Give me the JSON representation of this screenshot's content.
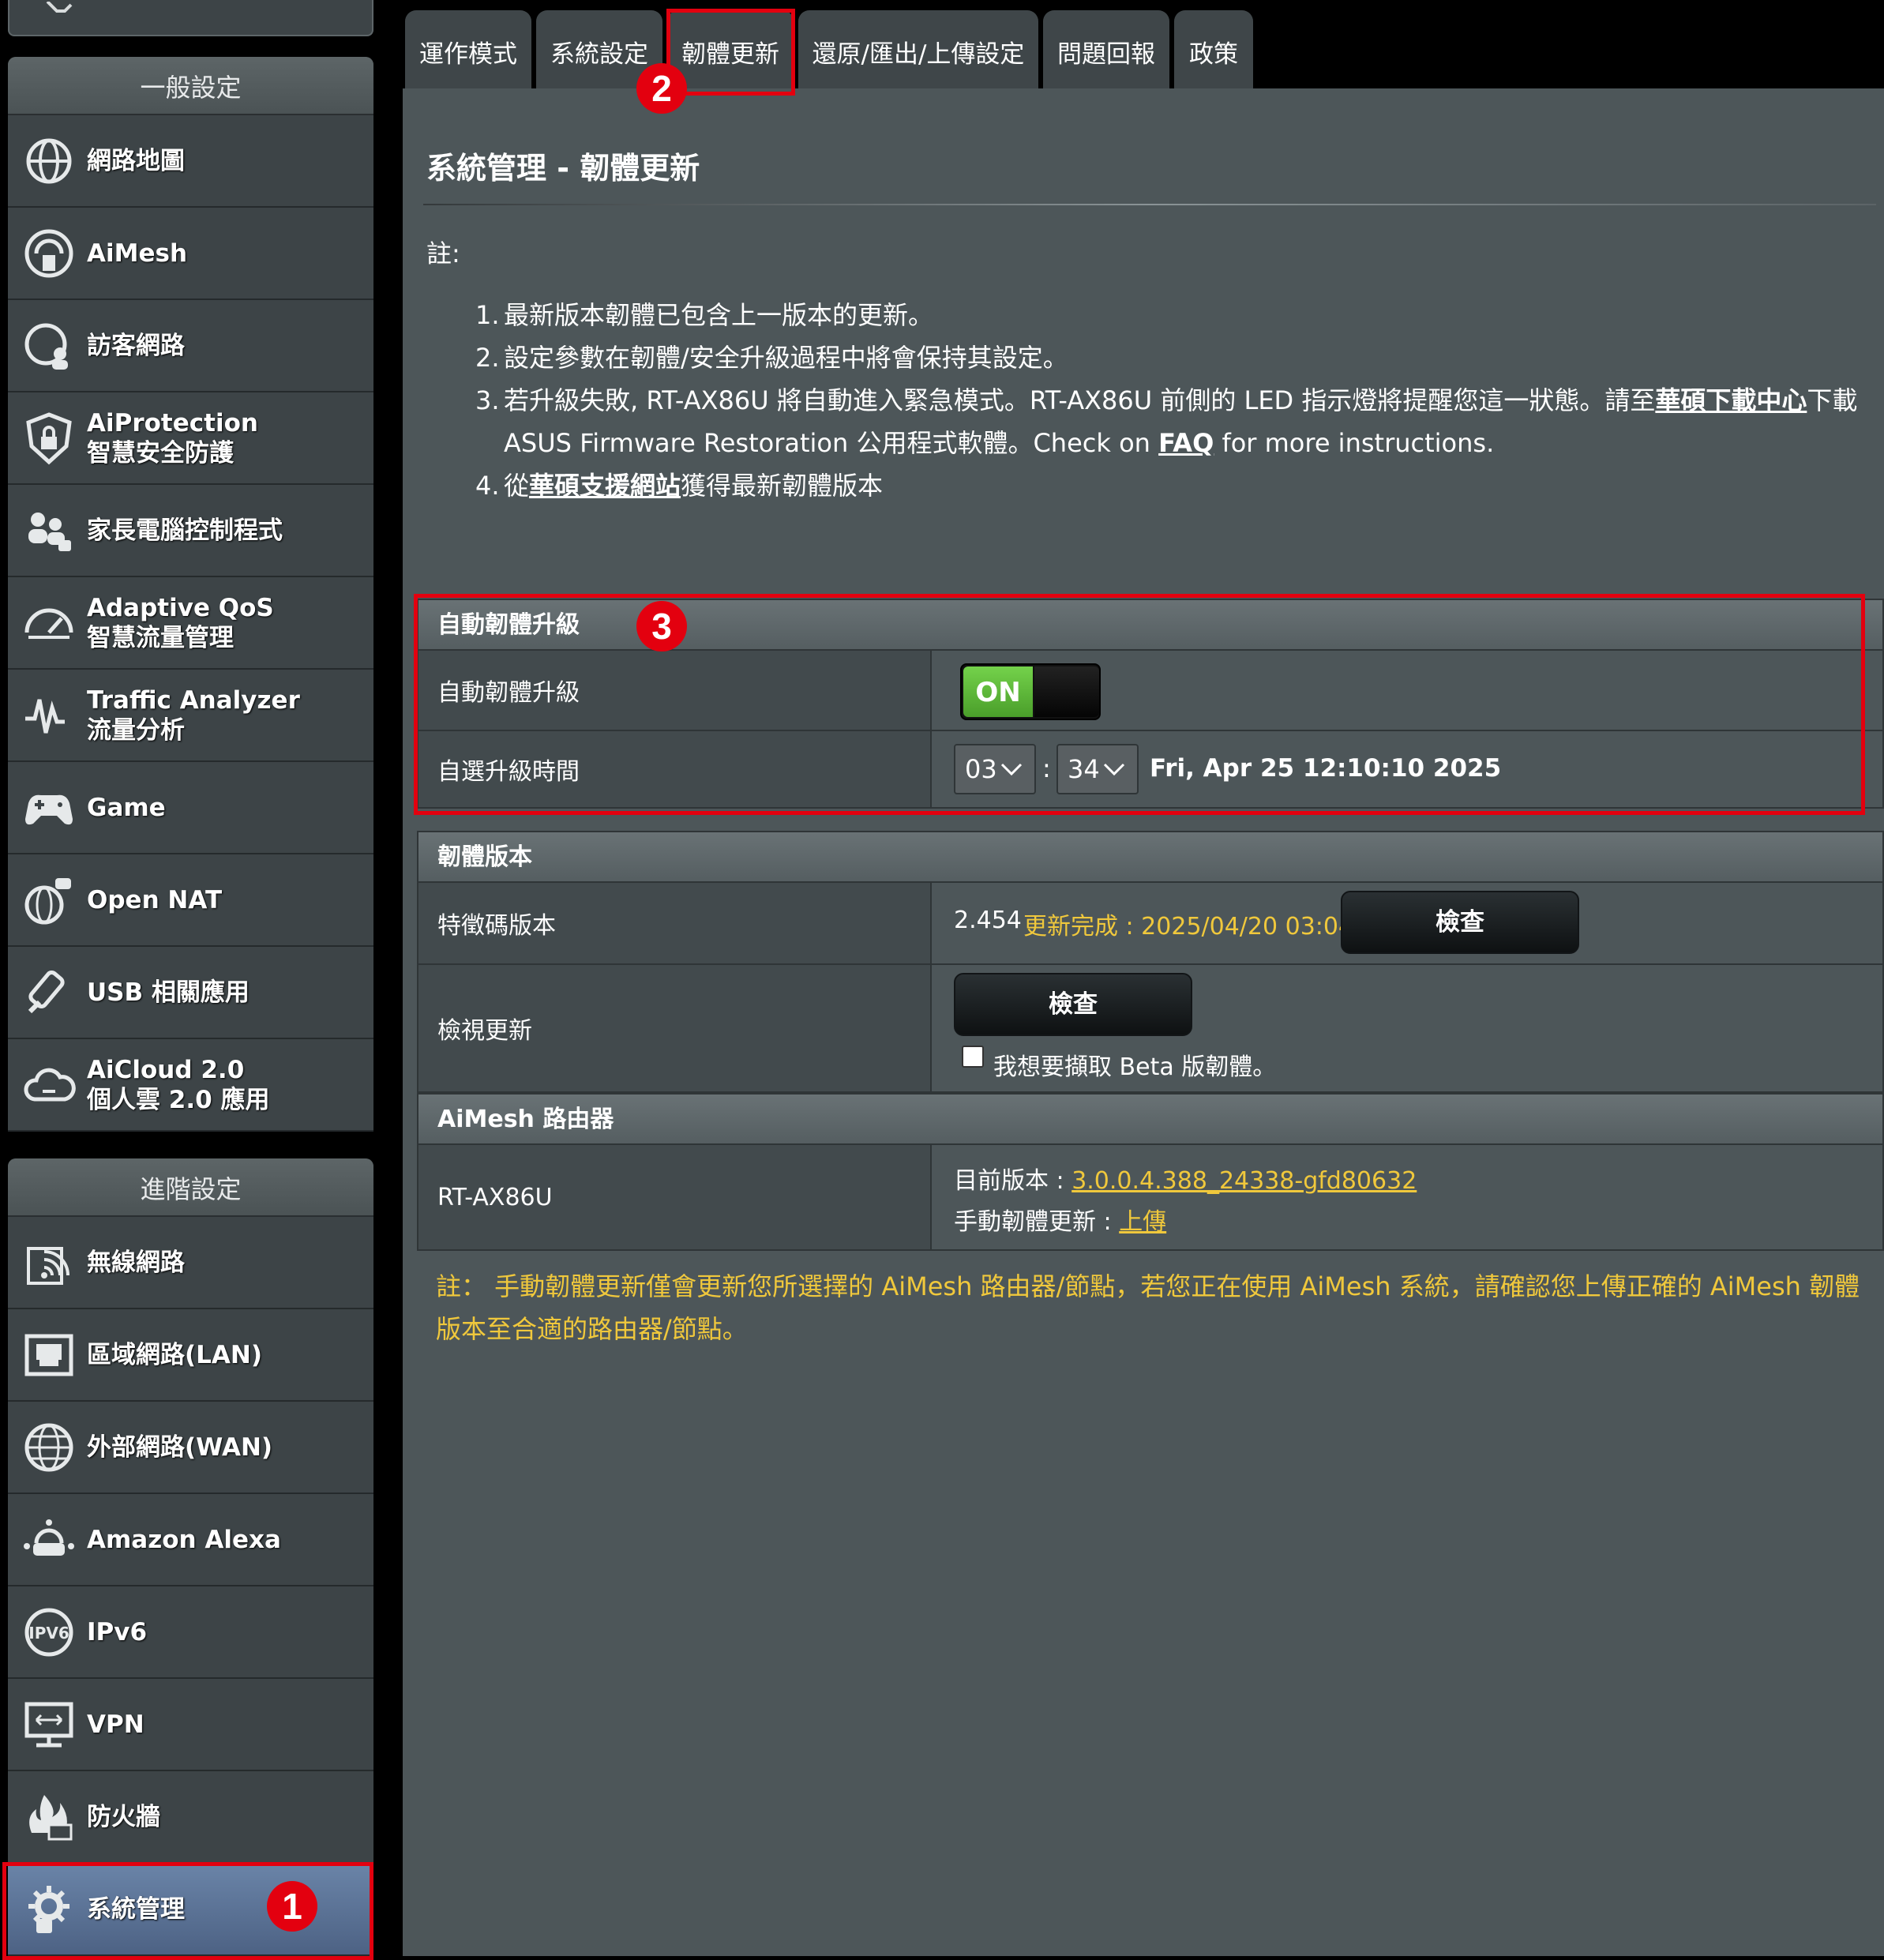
{
  "sidebar": {
    "general_header": "一般設定",
    "general_items": [
      {
        "icon": "globe-network-icon",
        "lines": [
          "網路地圖"
        ]
      },
      {
        "icon": "aimesh-icon",
        "lines": [
          "AiMesh"
        ]
      },
      {
        "icon": "guest-network-icon",
        "lines": [
          "訪客網路"
        ]
      },
      {
        "icon": "shield-lock-icon",
        "lines": [
          "AiProtection",
          "智慧安全防護"
        ]
      },
      {
        "icon": "parental-control-icon",
        "lines": [
          "家長電腦控制程式"
        ]
      },
      {
        "icon": "speedometer-icon",
        "lines": [
          "Adaptive QoS",
          "智慧流量管理"
        ]
      },
      {
        "icon": "traffic-wave-icon",
        "lines": [
          "Traffic Analyzer",
          "流量分析"
        ]
      },
      {
        "icon": "gamepad-icon",
        "lines": [
          "Game"
        ]
      },
      {
        "icon": "open-nat-icon",
        "lines": [
          "Open NAT"
        ]
      },
      {
        "icon": "usb-icon",
        "lines": [
          "USB 相關應用"
        ]
      },
      {
        "icon": "cloud-icon",
        "lines": [
          "AiCloud 2.0",
          "個人雲 2.0 應用"
        ]
      }
    ],
    "advanced_header": "進階設定",
    "advanced_items": [
      {
        "icon": "wireless-icon",
        "lines": [
          "無線網路"
        ]
      },
      {
        "icon": "lan-port-icon",
        "lines": [
          "區域網路(LAN)"
        ]
      },
      {
        "icon": "wan-globe-icon",
        "lines": [
          "外部網路(WAN)"
        ]
      },
      {
        "icon": "alexa-icon",
        "lines": [
          "Amazon Alexa"
        ]
      },
      {
        "icon": "ipv6-icon",
        "lines": [
          "IPv6"
        ]
      },
      {
        "icon": "vpn-monitor-icon",
        "lines": [
          "VPN"
        ]
      },
      {
        "icon": "firewall-icon",
        "lines": [
          "防火牆"
        ]
      },
      {
        "icon": "system-admin-gear-icon",
        "lines": [
          "系統管理"
        ],
        "active": true
      }
    ]
  },
  "tabs": [
    {
      "label": "運作模式"
    },
    {
      "label": "系統設定"
    },
    {
      "label": "韌體更新",
      "active": true
    },
    {
      "label": "還原/匯出/上傳設定"
    },
    {
      "label": "問題回報"
    },
    {
      "label": "政策"
    }
  ],
  "page": {
    "title": "系統管理 - 韌體更新",
    "note_label": "註:",
    "notes": {
      "n1": "最新版本韌體已包含上一版本的更新。",
      "n2": "設定參數在韌體/安全升級過程中將會保持其設定。",
      "n3_a": "若升級失敗, RT-AX86U 將自動進入緊急模式。RT-AX86U 前側的 LED 指示燈將提醒您這一狀態。請至",
      "n3_link1": "華碩下載中心",
      "n3_b": "下載 ASUS Firmware Restoration 公用程式軟體。Check on ",
      "n3_link2": "FAQ",
      "n3_c": " for more instructions.",
      "n4_a": "從",
      "n4_link": "華碩支援網站",
      "n4_b": "獲得最新韌體版本"
    }
  },
  "auto_upgrade": {
    "header": "自動韌體升級",
    "toggle_label": "自動韌體升級",
    "toggle_value": "ON",
    "time_label": "自選升級時間",
    "hour": "03",
    "minute": "34",
    "time_sep": ":",
    "current_datetime": "Fri, Apr 25 12:10:10 2025"
  },
  "firmware": {
    "header": "韌體版本",
    "signature_label": "特徵碼版本",
    "signature_version": "2.454",
    "signature_status": "更新完成 : 2025/04/20 03:04",
    "check_button": "檢查",
    "check_update_label": "檢視更新",
    "check_update_button": "檢查",
    "beta_checkbox_label": "我想要擷取 Beta 版韌體。",
    "beta_checked": false
  },
  "aimesh": {
    "header": "AiMesh 路由器",
    "model": "RT-AX86U",
    "current_version_label": "目前版本 : ",
    "current_version": "3.0.0.4.388_24338-gfd80632",
    "manual_update_label": "手動韌體更新 : ",
    "manual_update_link": "上傳"
  },
  "footer_note": "註： 手動韌體更新僅會更新您所選擇的 AiMesh 路由器/節點，若您正在使用 AiMesh 系統，請確認您上傳正確的 AiMesh 韌體版本至合適的路由器/節點。",
  "callouts": [
    "1",
    "2",
    "3"
  ],
  "colors": {
    "accent_red": "#e3000f",
    "highlight_yellow": "#f0c83c",
    "toggle_green": "#5cb832",
    "active_nav": "#5a6f94"
  }
}
